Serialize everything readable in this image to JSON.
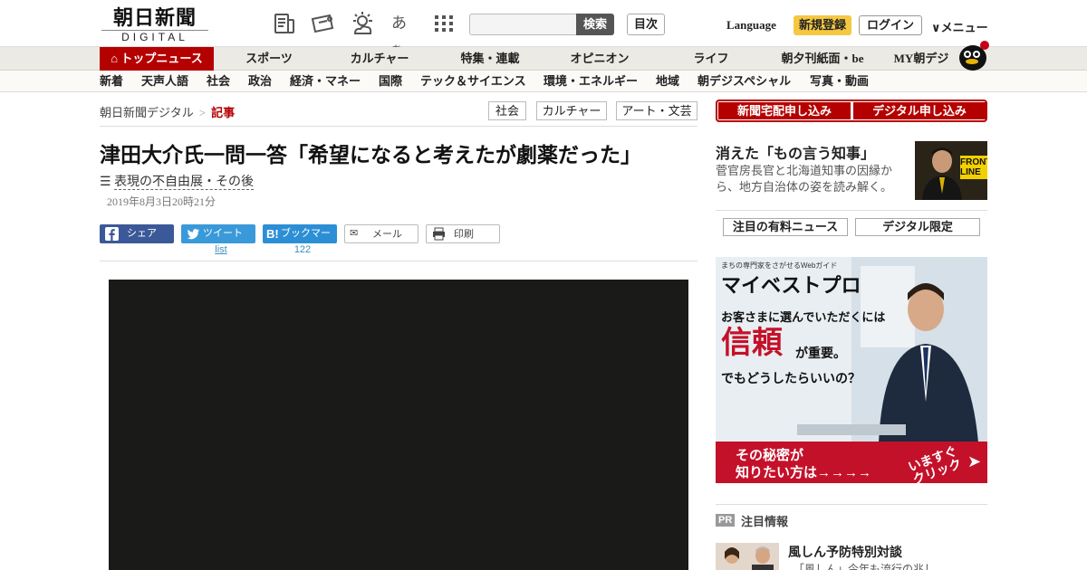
{
  "header": {
    "logo_jp": "朝日新聞",
    "logo_en": "DIGITAL",
    "search_button": "検索",
    "search_placeholder": "",
    "index_button": "目次",
    "language": "Language",
    "signup": "新規登録",
    "login": "ログイン",
    "menu": "メニュー"
  },
  "nav": {
    "main": [
      "トップニュース",
      "スポーツ",
      "カルチャー",
      "特集・連載",
      "オピニオン",
      "ライフ",
      "朝夕刊紙面・be",
      "MY朝デジ"
    ],
    "sub": [
      "新着",
      "天声人語",
      "社会",
      "政治",
      "経済・マネー",
      "国際",
      "テック＆サイエンス",
      "環境・エネルギー",
      "地域",
      "朝デジスペシャル",
      "写真・動画"
    ]
  },
  "breadcrumb": {
    "home": "朝日新聞デジタル",
    "sep": ">",
    "current": "記事"
  },
  "tags": [
    "社会",
    "カルチャー",
    "アート・文芸"
  ],
  "article": {
    "title": "津田大介氏一問一答「希望になると考えたが劇薬だった」",
    "series": "表現の不自由展・その後",
    "date": "2019年8月3日20時21分",
    "share": {
      "facebook": "シェア",
      "twitter": "ツイート",
      "hatena": "ブックマーク",
      "mail": "メール",
      "print": "印刷",
      "twitter_count": "list",
      "hatena_count": "122"
    }
  },
  "sidebar": {
    "subscribe_paper": "新聞宅配申し込み",
    "subscribe_digital": "デジタル申し込み",
    "feature_title": "消えた「もの言う知事」",
    "feature_desc": "菅官房長官と北海道知事の因縁から、地方自治体の姿を読み解く。",
    "feature_img_text": "FRONT LINE",
    "tab_paid": "注目の有料ニュース",
    "tab_digital": "デジタル限定",
    "ad": {
      "tagline": "まちの専門家をさがせるWebガイド",
      "brand": "マイベストプロ",
      "line1": "お客さまに選んでいただくには",
      "big": "信頼",
      "line2": "が重要。",
      "line3": "でもどうしたらいいの？",
      "cta1": "その秘密が",
      "cta2": "知りたい方は→→→→",
      "cta3": "いますぐ クリック"
    },
    "pr_badge": "PR",
    "pr_title": "注目情報",
    "pr_headline": "風しん予防特別対談",
    "pr_sub": "「風しん」今年も流行の兆し"
  },
  "colors": {
    "brand_red": "#b50000",
    "signup_yellow": "#f5c842",
    "twitter": "#3a9ad9",
    "facebook": "#3b5998",
    "hatena": "#2c8fd6"
  }
}
